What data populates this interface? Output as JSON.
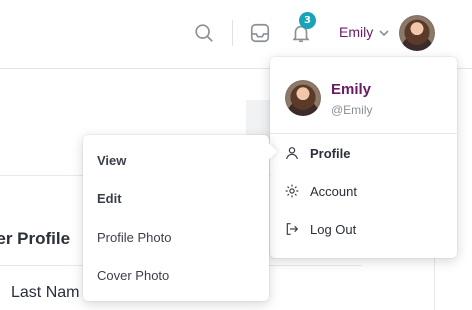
{
  "header": {
    "notifications_count": "3",
    "user_name": "Emily"
  },
  "background": {
    "section_title": "ner Profile",
    "field_label": "Last Nam"
  },
  "dropdown": {
    "name": "Emily",
    "handle": "@Emily",
    "items": [
      {
        "label": "Profile",
        "icon": "user-icon"
      },
      {
        "label": "Account",
        "icon": "gear-icon"
      },
      {
        "label": "Log Out",
        "icon": "logout-icon"
      }
    ]
  },
  "submenu": {
    "items": [
      "View",
      "Edit",
      "Profile Photo",
      "Cover Photo"
    ]
  },
  "colors": {
    "brand_purple": "#6a1b63",
    "badge_teal": "#19a3b8"
  }
}
